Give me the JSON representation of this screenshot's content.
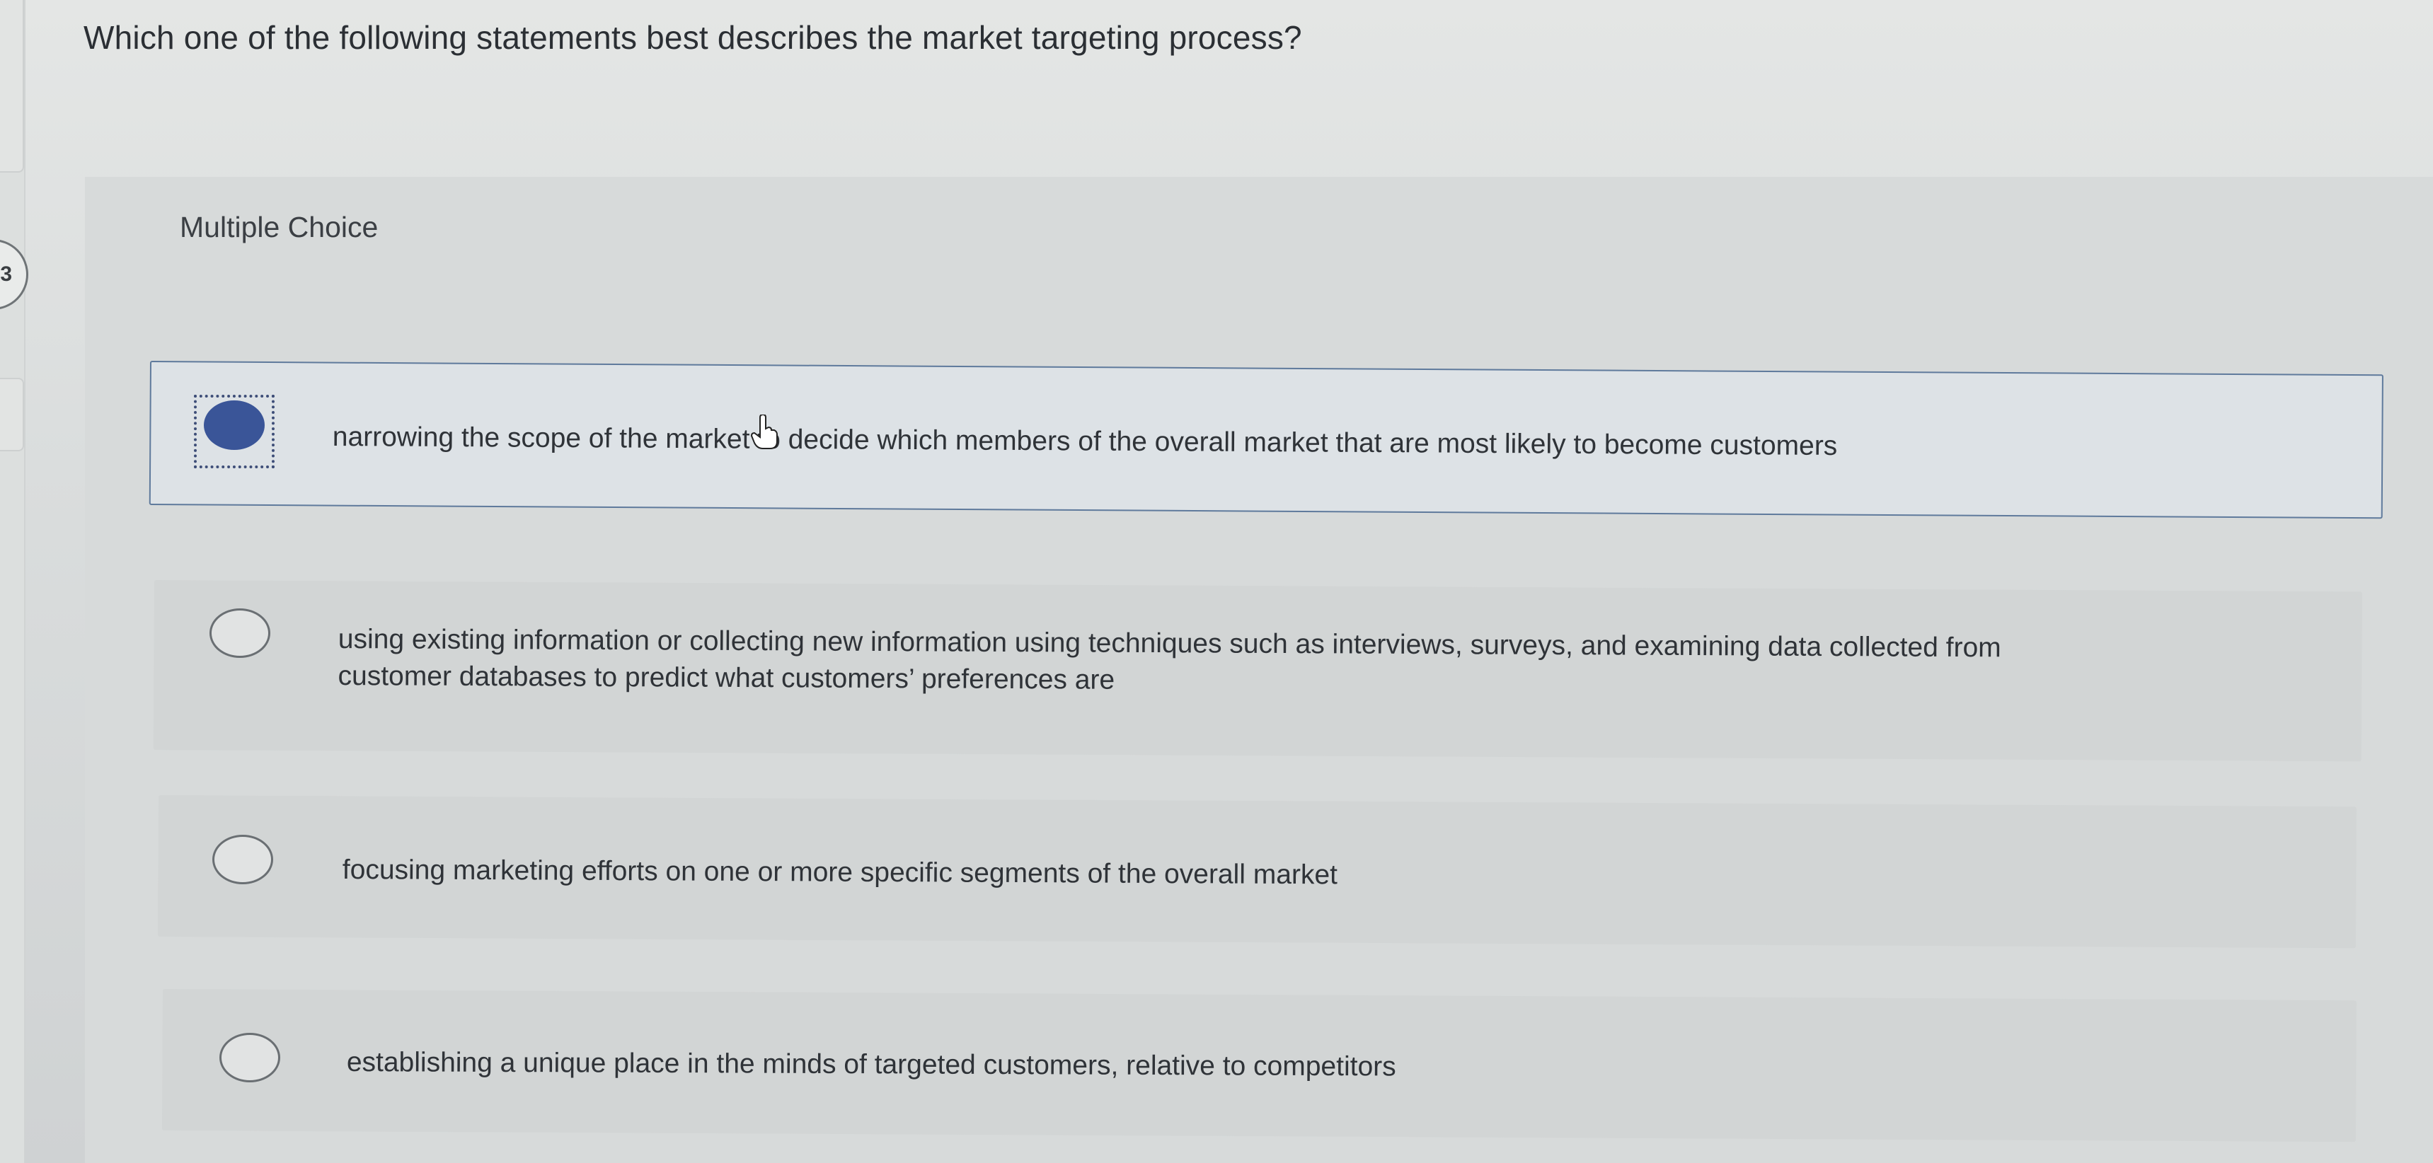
{
  "question": {
    "text": "Which one of the following statements best describes the market targeting process?",
    "number_badge": "3"
  },
  "panel": {
    "label": "Multiple Choice"
  },
  "options": [
    {
      "text": "narrowing the scope of the market to decide which members of the overall market that are most likely to become customers",
      "selected": true
    },
    {
      "text_line1": "using existing information or collecting new information using techniques such as interviews, surveys, and examining data collected from",
      "text_line2": "customer databases to predict what customers’ preferences are",
      "selected": false
    },
    {
      "text": "focusing marketing efforts on one or more specific segments of the overall market",
      "selected": false
    },
    {
      "text": "establishing a unique place in the minds of targeted customers, relative to competitors",
      "selected": false
    }
  ],
  "colors": {
    "selected_radio": "#3a5598",
    "selected_border": "#5f7a9c"
  },
  "icons": {
    "cursor": "hand-pointer-icon"
  }
}
